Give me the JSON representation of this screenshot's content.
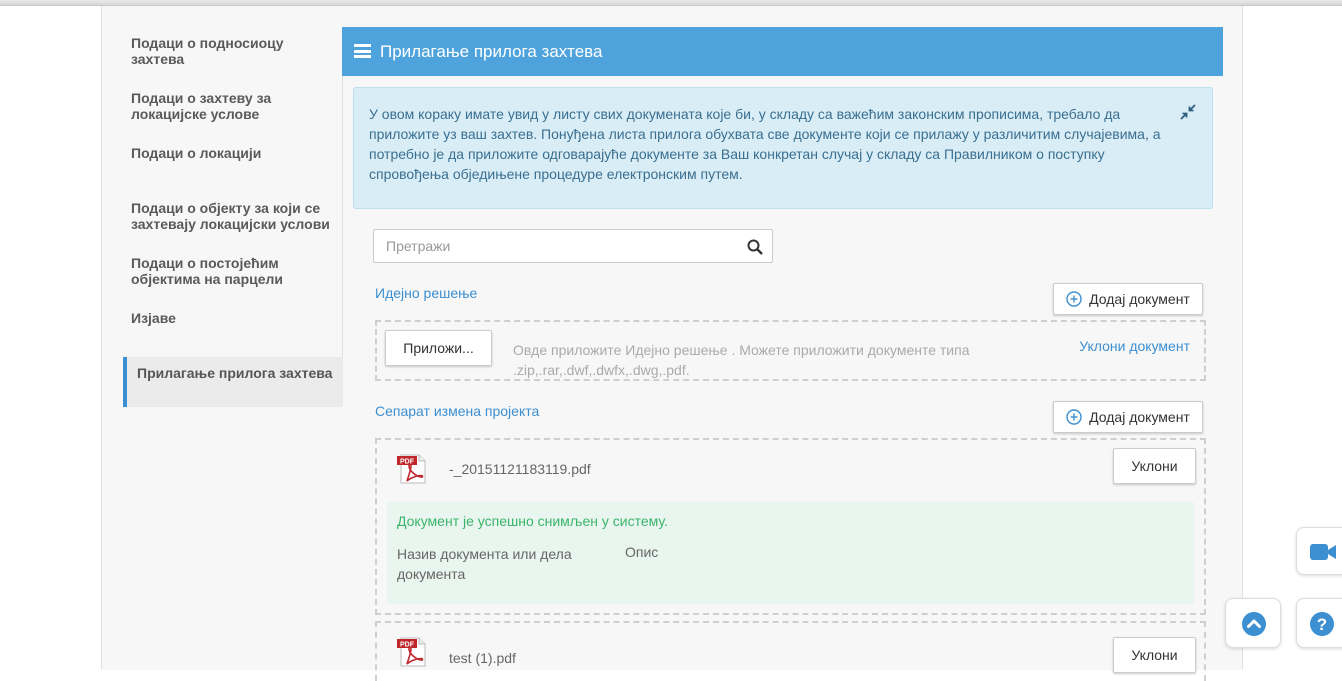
{
  "sidebar": {
    "items": [
      {
        "label": "Подаци о подносиоцу захтева"
      },
      {
        "label": "Подаци о захтеву за локацијске услове"
      },
      {
        "label": "Подаци о локацији"
      },
      {
        "label": "Подаци о објекту за који се захтевају локацијски услови"
      },
      {
        "label": "Подаци о постојећим објектима на парцели"
      },
      {
        "label": "Изјаве"
      },
      {
        "label": "Прилагање прилога захтева",
        "active": true
      }
    ]
  },
  "panel": {
    "title": "Прилагање прилога захтева",
    "info_text": "У овом кораку имате увид у листу свих докумената које би, у складу са важећим законским прописима, требало да приложите уз ваш захтев. Понуђена листа прилога обухвата све документе који се прилажу у различитим случајевима, а потребно је да приложите одговарајуће документе за Ваш конкретан случај у складу са Правилником о поступку спровођења обједињене процедуре електронским путем."
  },
  "search": {
    "placeholder": "Претражи"
  },
  "sections": [
    {
      "label": "Идејно решење",
      "add_label": "Додај документ",
      "attach_label": "Приложи...",
      "hint": "Овде приложите Идејно решење . Можете приложити документе типа .zip,.rar,.dwf,.dwfx,.dwg,.pdf.",
      "remove_link": "Уклони документ"
    },
    {
      "label": "Сепарат измена пројекта",
      "add_label": "Додај документ",
      "files": [
        {
          "name": "-_20151121183119.pdf",
          "remove_label": "Уклони",
          "success_msg": "Документ је успешно снимљен у систему.",
          "doc_name_label": "Назив документа или дела документа",
          "desc_label": "Опис"
        },
        {
          "name": "test (1).pdf",
          "remove_label": "Уклони"
        }
      ]
    }
  ],
  "icons": {
    "menu": "hamburger-icon",
    "collapse": "compress-icon",
    "search": "search-icon",
    "add": "plus-circle-icon",
    "pdf": "pdf-file-icon",
    "video": "video-camera-icon",
    "scroll_top": "chevron-up-icon",
    "help": "question-icon"
  },
  "colors": {
    "accent": "#4fa3dc",
    "link": "#3c8fd1",
    "info_bg": "#d9edf7",
    "success": "#3bb56a",
    "active_border": "#3c8fd1"
  }
}
